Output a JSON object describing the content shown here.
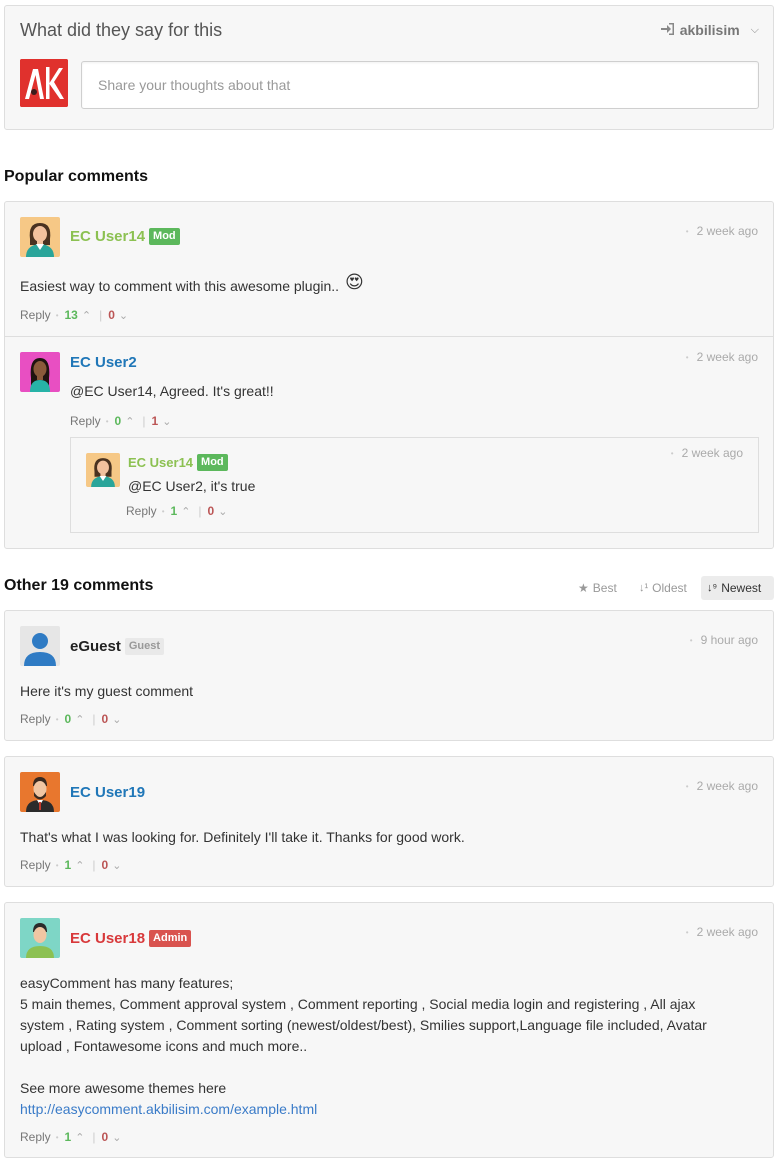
{
  "header": {
    "title": "What did they say for this",
    "user": "akbilisim",
    "input_placeholder": "Share your thoughts about that",
    "logo_text": "AK"
  },
  "popular": {
    "title": "Popular comments",
    "comment": {
      "name": "EC User14",
      "badge": "Mod",
      "time": "2 week ago",
      "text": "Easiest way to comment with this awesome plugin..",
      "emoji": "😍",
      "reply": "Reply",
      "up": "13",
      "down": "0"
    },
    "reply1": {
      "name": "EC User2",
      "time": "2 week ago",
      "text": "@EC User14, Agreed. It's great!!",
      "reply": "Reply",
      "up": "0",
      "down": "1"
    },
    "reply2": {
      "name": "EC User14",
      "badge": "Mod",
      "time": "2 week ago",
      "text": "@EC User2, it's true",
      "reply": "Reply",
      "up": "1",
      "down": "0"
    }
  },
  "other": {
    "title": "Other 19 comments",
    "sort": {
      "best": "Best",
      "oldest": "Oldest",
      "newest": "Newest",
      "active": "newest"
    },
    "comments": [
      {
        "name": "eGuest",
        "badge": "Guest",
        "time": "9 hour ago",
        "text": "Here it's my guest comment",
        "reply": "Reply",
        "up": "0",
        "down": "0"
      },
      {
        "name": "EC User19",
        "time": "2 week ago",
        "text": "That's what I was looking for. Definitely I'll take it. Thanks for good work.",
        "reply": "Reply",
        "up": "1",
        "down": "0"
      },
      {
        "name": "EC User18",
        "badge": "Admin",
        "time": "2 week ago",
        "text_line1": "easyComment has many features;",
        "text_line2": "5 main themes, Comment approval system , Comment reporting , Social media login and registering , All ajax system , Rating system , Comment sorting (newest/oldest/best), Smilies support,Language file included, Avatar upload , Fontawesome icons and much more..",
        "text_line3": "See more awesome themes here",
        "link": "http://easycomment.akbilisim.com/example.html",
        "reply": "Reply",
        "up": "1",
        "down": "0"
      }
    ]
  },
  "colors": {
    "mod": "#5cb85c",
    "admin": "#d9534f",
    "user_blue": "#2077b8",
    "user_green": "#8cc152",
    "user_red": "#d8393b",
    "logo": "#e0312d"
  }
}
